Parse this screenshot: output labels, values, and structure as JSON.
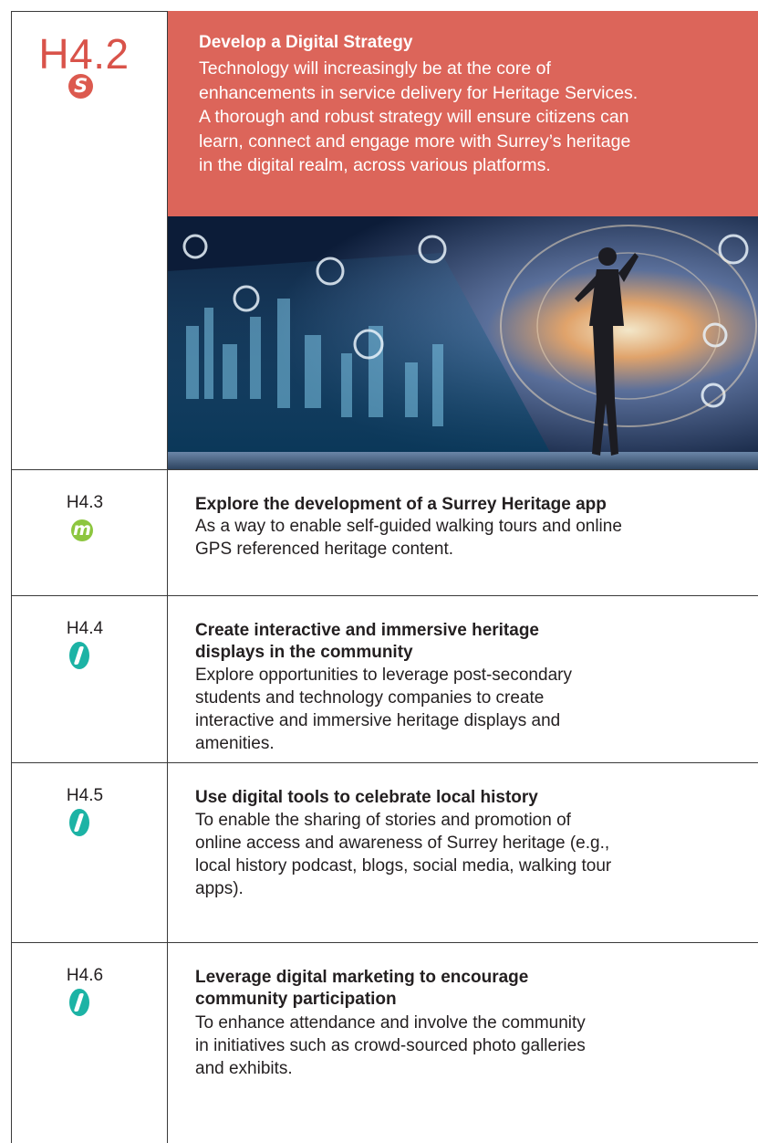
{
  "rows": [
    {
      "code": "H4.2",
      "badge": "S",
      "title": "Develop a Digital Strategy",
      "lines": [
        "Technology will increasingly be at the core of",
        "enhancements in service delivery for Heritage Services.",
        "A thorough and robust strategy will ensure citizens can",
        "learn, connect and engage more with Surrey’s heritage",
        "in the digital realm, across various platforms."
      ],
      "image_alt": "woman-touching-digital-city-interface-photo"
    },
    {
      "code": "H4.3",
      "badge": "m",
      "title_lines": [
        "Explore the development of a Surrey Heritage app"
      ],
      "lines": [
        "As a way to enable self-guided walking tours and online",
        "GPS referenced heritage content."
      ]
    },
    {
      "code": "H4.4",
      "badge": "l",
      "title_lines": [
        "Create interactive and immersive heritage",
        "displays in the community"
      ],
      "lines": [
        "Explore opportunities to leverage post-secondary",
        "students and technology companies to create",
        "interactive and immersive heritage displays and",
        "amenities."
      ]
    },
    {
      "code": "H4.5",
      "badge": "l",
      "title_lines": [
        "Use digital tools to celebrate local history"
      ],
      "lines": [
        "To enable the sharing of stories and promotion of",
        "online access and awareness of Surrey heritage (e.g.,",
        "local history podcast, blogs, social media, walking tour",
        "apps)."
      ]
    },
    {
      "code": "H4.6",
      "badge": "l",
      "title_lines": [
        "Leverage digital marketing to encourage",
        "community participation"
      ],
      "lines": [
        "To enhance attendance and involve the community",
        "in initiatives such as crowd-sourced photo galleries",
        "and exhibits."
      ]
    }
  ],
  "colors": {
    "accent_red": "#dc655a",
    "badge_s": "#dc5a4f",
    "badge_m": "#8dc63f",
    "badge_l": "#1cb3a5",
    "text": "#231f20",
    "rule": "#3a3a3a"
  }
}
